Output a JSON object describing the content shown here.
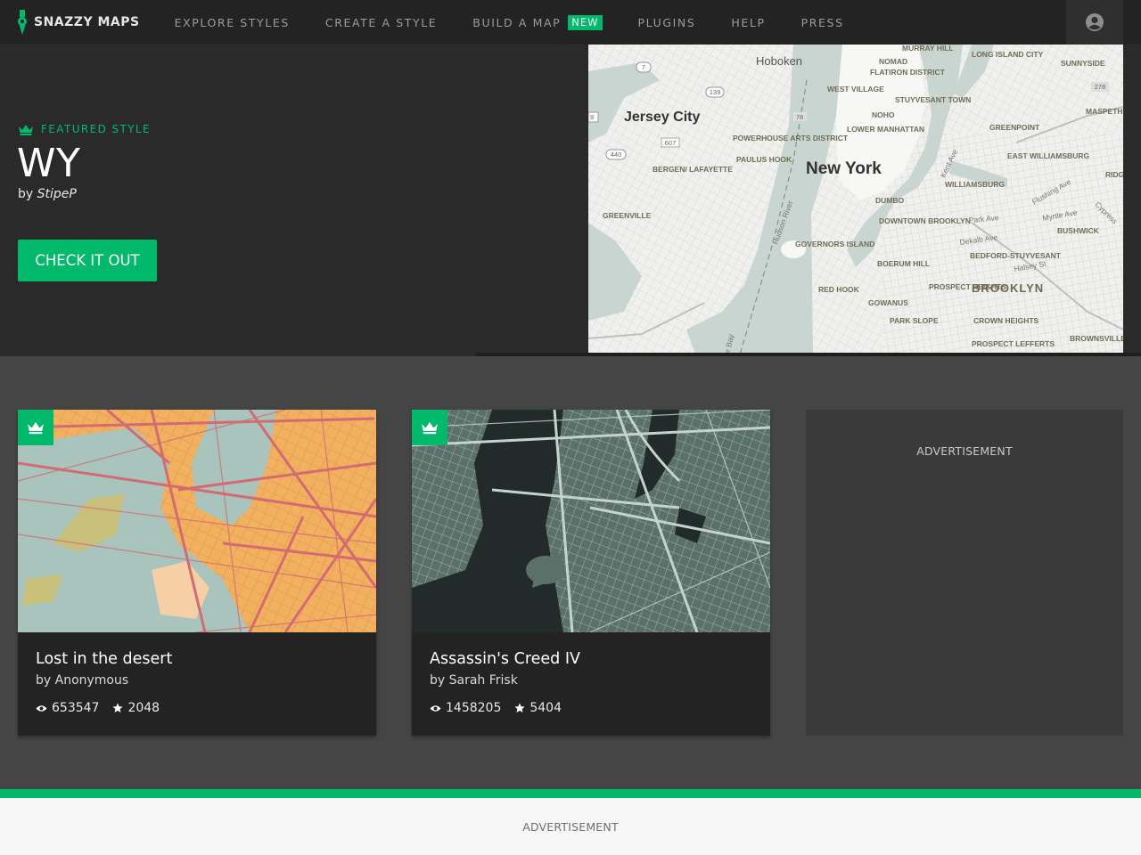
{
  "nav": {
    "brand": "SNAZZY MAPS",
    "items": [
      {
        "label": "EXPLORE STYLES"
      },
      {
        "label": "CREATE A STYLE"
      },
      {
        "label": "BUILD A MAP",
        "badge": "NEW"
      },
      {
        "label": "PLUGINS"
      },
      {
        "label": "HELP"
      },
      {
        "label": "PRESS"
      }
    ]
  },
  "hero": {
    "featured_label": "FEATURED STYLE",
    "title": "WY",
    "by": "by",
    "author": "StipeP",
    "cta": "CHECK IT OUT",
    "map_labels": {
      "hoboken": "Hoboken",
      "jersey_city": "Jersey City",
      "new_york": "New York",
      "brooklyn": "BROOKLYN",
      "murray_hill": "MURRAY HILL",
      "long_island_city": "LONG ISLAND CITY",
      "sunnyside": "SUNNYSIDE",
      "nomad": "NOMAD",
      "flatiron": "FLATIRON DISTRICT",
      "west_village": "WEST VILLAGE",
      "stuyvesant": "STUYVESANT TOWN",
      "noho": "NOHO",
      "greenpoint": "GREENPOINT",
      "maspeth": "MASPETH",
      "lower_manhattan": "LOWER MANHATTAN",
      "powerhouse": "POWERHOUSE ARTS DISTRICT",
      "paulus_hook": "PAULUS HOOK",
      "east_williamsburg": "EAST WILLIAMSBURG",
      "bergen": "BERGEN/ LAFAYETTE",
      "williamsburg": "WILLIAMSBURG",
      "dumbo": "DUMBO",
      "greenville": "GREENVILLE",
      "downtown_brooklyn": "DOWNTOWN BROOKLYN",
      "bushwick": "BUSHWICK",
      "governors_island": "GOVERNORS ISLAND",
      "bedford": "BEDFORD-STUYVESANT",
      "boerum_hill": "BOERUM HILL",
      "red_hook": "RED HOOK",
      "prospect_heights": "PROSPECT HEIGHTS",
      "gowanus": "GOWANUS",
      "park_slope": "PARK SLOPE",
      "crown_heights": "CROWN HEIGHTS",
      "prospect_lefferts": "PROSPECT LEFFERTS",
      "brownsville": "BROWNSVILLE",
      "hudson_river": "Hudson River",
      "bay": "er Bay",
      "kent_ave": "Kent Ave",
      "park_ave": "Park Ave",
      "myrtle_ave": "Myrtle Ave",
      "dekalb_ave": "Dekalb Ave",
      "halsey_st": "Halsey St",
      "flushing_ave": "Flushing Ave",
      "cypress": "Cypress",
      "ridge": "RIDG",
      "route_7": "7",
      "route_139": "139",
      "route_78": "78",
      "route_278": "278",
      "route_607": "607",
      "route_440": "440",
      "route_9": "9"
    }
  },
  "cards": [
    {
      "title": "Lost in the desert",
      "author": "by Anonymous",
      "views": "653547",
      "stars": "2048"
    },
    {
      "title": "Assassin's Creed IV",
      "author": "by Sarah Frisk",
      "views": "1458205",
      "stars": "5404"
    }
  ],
  "ads": {
    "sidebar": "ADVERTISEMENT",
    "footer": "ADVERTISEMENT"
  },
  "colors": {
    "accent": "#00b96b",
    "nav_bg": "#232323",
    "hero_bg": "#2a2a2a",
    "page_bg": "#454545"
  },
  "icons": [
    "map-pin-icon",
    "user-icon",
    "crown-icon",
    "eye-icon",
    "star-icon"
  ]
}
